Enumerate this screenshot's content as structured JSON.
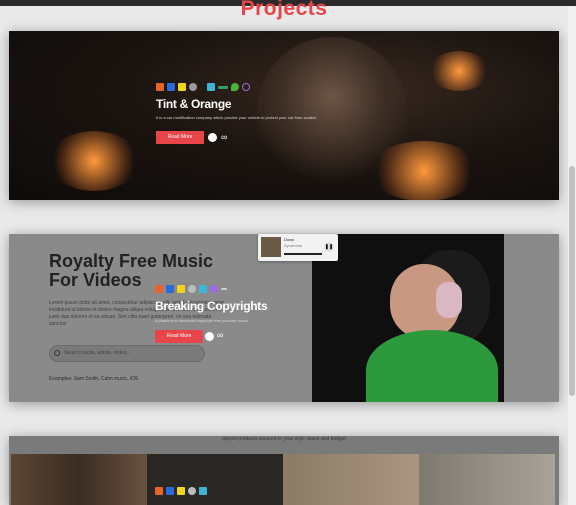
{
  "section_title": "Projects",
  "projects": [
    {
      "title": "Tint & Orange",
      "description": "It is a car modification company which provide your vehicle to protect your car from scratch",
      "button": "Read More"
    },
    {
      "title": "Breaking Copyrights",
      "description": "A platform to download copyright free youtube music",
      "button": "Read More"
    }
  ],
  "music_site": {
    "heading": "Royalty Free Music For Videos",
    "body": "Lorem ipsum dolor sit amet, consectetur adipiscing elit, sed do eiusmod tempor incididunt ut labore et dolore magna aliqua volutpat. At vero eos et accusam et justo duo dolores et ea rebum. Stet clita kasd gubergren, no sea takimata sanctus",
    "search_placeholder": "Search tracks, artists, styles...",
    "examples": "Examples: Sam Smith, Calm music, iOS",
    "player": {
      "track": "Down",
      "artist": "Syndrome"
    }
  },
  "furniture_caption": "played products secured to your style space and budget",
  "colors": {
    "accent": "#e8454a"
  }
}
